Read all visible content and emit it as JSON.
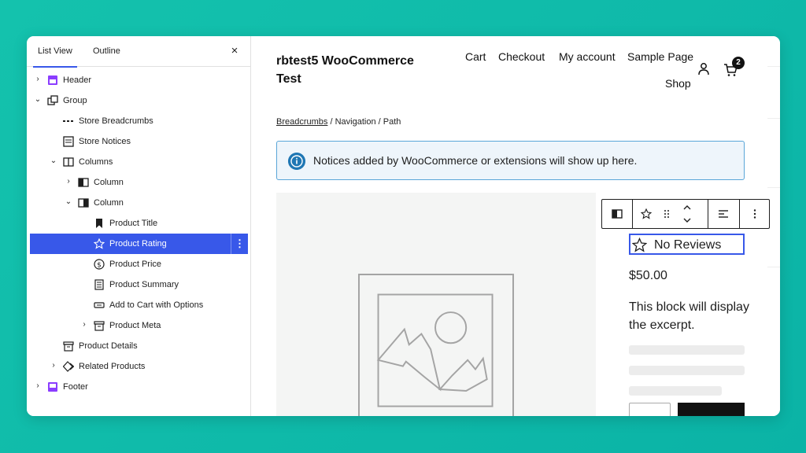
{
  "panel": {
    "tabs": [
      "List View",
      "Outline"
    ],
    "close_label": "×",
    "items": [
      {
        "label": "Header",
        "chevron": "›",
        "icon": "header-icon"
      },
      {
        "label": "Group",
        "chevron": "⌄",
        "icon": "group-icon"
      },
      {
        "label": "Store Breadcrumbs",
        "chevron": "",
        "icon": "breadcrumbs-icon"
      },
      {
        "label": "Store Notices",
        "chevron": "",
        "icon": "notices-icon"
      },
      {
        "label": "Columns",
        "chevron": "⌄",
        "icon": "columns-icon"
      },
      {
        "label": "Column",
        "chevron": "›",
        "icon": "column-icon"
      },
      {
        "label": "Column",
        "chevron": "⌄",
        "icon": "column-icon"
      },
      {
        "label": "Product Title",
        "chevron": "",
        "icon": "bookmark-icon"
      },
      {
        "label": "Product Rating",
        "chevron": "",
        "icon": "star-icon"
      },
      {
        "label": "Product Price",
        "chevron": "",
        "icon": "dollar-icon"
      },
      {
        "label": "Product Summary",
        "chevron": "",
        "icon": "summary-icon"
      },
      {
        "label": "Add to Cart with Options",
        "chevron": "",
        "icon": "button-icon"
      },
      {
        "label": "Product Meta",
        "chevron": "›",
        "icon": "archive-icon"
      },
      {
        "label": "Product Details",
        "chevron": "",
        "icon": "details-icon"
      },
      {
        "label": "Related Products",
        "chevron": "›",
        "icon": "related-icon"
      },
      {
        "label": "Footer",
        "chevron": "›",
        "icon": "footer-icon"
      }
    ],
    "more_label": "⋮"
  },
  "site": {
    "title": "rbtest5 WooCommerce Test",
    "nav": [
      "Cart",
      "Checkout",
      "My account",
      "Sample Page",
      "Shop"
    ],
    "cart_count": "2"
  },
  "breadcrumbs": {
    "link": "Breadcrumbs",
    "rest": " / Navigation / Path"
  },
  "notice": {
    "text": "Notices added by WooCommerce or extensions will show up here."
  },
  "product": {
    "rating_text": "No Reviews",
    "price": "$50.00",
    "excerpt": "This block will display the excerpt."
  },
  "colors": {
    "accent": "#3858e9",
    "background": "#12c0ab",
    "notice_border": "#5aa6d8",
    "notice_bg": "#eef5fb",
    "info_icon": "#1f77b4"
  }
}
